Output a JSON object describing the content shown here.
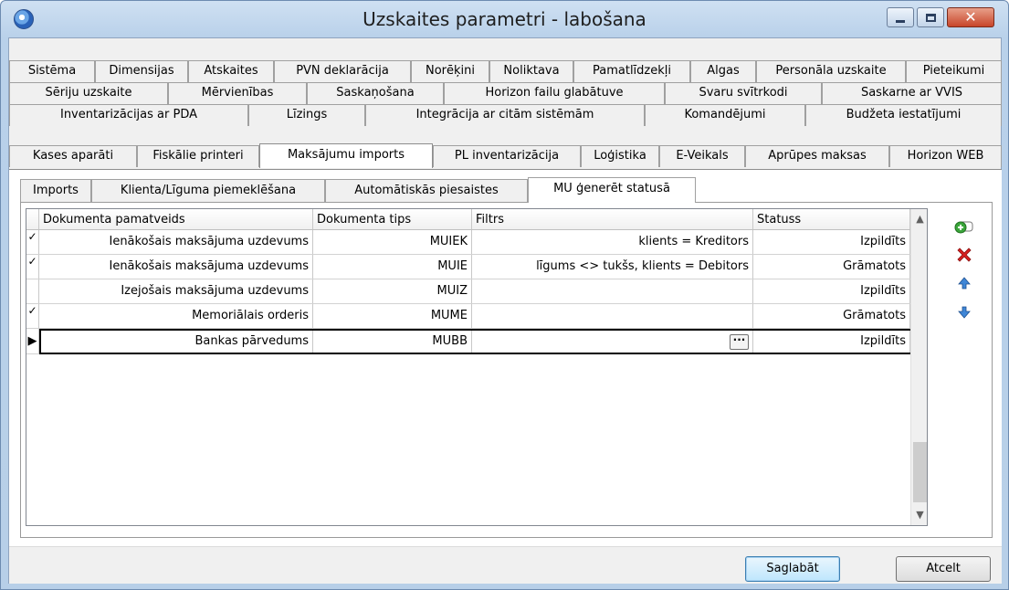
{
  "window": {
    "title": "Uzskaites parametri - labošana"
  },
  "tab_rows": [
    [
      "Sistēma",
      "Dimensijas",
      "Atskaites",
      "PVN deklarācija",
      "Norēķini",
      "Noliktava",
      "Pamatlīdzekļi",
      "Algas",
      "Personāla uzskaite",
      "Pieteikumi"
    ],
    [
      "Sēriju uzskaite",
      "Mērvienības",
      "Saskaņošana",
      "Horizon failu glabātuve",
      "Svaru svītrkodi",
      "Saskarne ar VVIS"
    ],
    [
      "Inventarizācijas ar PDA",
      "Līzings",
      "Integrācija ar citām sistēmām",
      "Komandējumi",
      "Budžeta iestatījumi"
    ],
    [
      "Kases aparāti",
      "Fiskālie printeri",
      "Maksājumu imports",
      "PL inventarizācija",
      "Loģistika",
      "E-Veikals",
      "Aprūpes maksas",
      "Horizon WEB"
    ]
  ],
  "active_tab": "Maksājumu imports",
  "sub_tabs": [
    "Imports",
    "Klienta/Līguma piemeklēšana",
    "Automātiskās piesaistes",
    "MU ģenerēt statusā"
  ],
  "active_sub_tab": "MU ģenerēt statusā",
  "grid": {
    "columns": [
      "Dokumenta pamatveids",
      "Dokumenta tips",
      "Filtrs",
      "Statuss"
    ],
    "rows": [
      {
        "check": "✓",
        "pamatveids": "Ienākošais maksājuma uzdevums",
        "tips": "MUIEK",
        "filtrs": "klients = Kreditors",
        "statuss": "Izpildīts"
      },
      {
        "check": "✓",
        "pamatveids": "Ienākošais maksājuma uzdevums",
        "tips": "MUIE",
        "filtrs": "līgums <> tukšs, klients = Debitors",
        "statuss": "Grāmatots"
      },
      {
        "check": "",
        "pamatveids": "Izejošais maksājuma uzdevums",
        "tips": "MUIZ",
        "filtrs": "",
        "statuss": "Izpildīts"
      },
      {
        "check": "✓",
        "pamatveids": "Memoriālais orderis",
        "tips": "MUME",
        "filtrs": "",
        "statuss": "Grāmatots"
      },
      {
        "check": "▶",
        "pamatveids": "Bankas pārvedums",
        "tips": "MUBB",
        "filtrs": "",
        "statuss": "Izpildīts"
      }
    ],
    "ellipsis": "···"
  },
  "buttons": {
    "save": "Saglabāt",
    "cancel": "Atcelt"
  },
  "colors": {
    "add": "#3aa53a",
    "delete": "#d82020",
    "arrow": "#3f86d6"
  }
}
